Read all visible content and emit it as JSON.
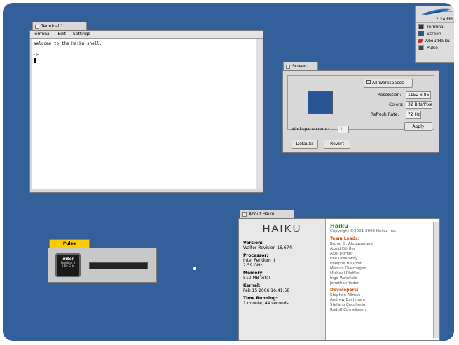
{
  "deskbar": {
    "clock": "2:24 PM",
    "items": [
      {
        "label": "Terminal",
        "icon": "terminal-icon"
      },
      {
        "label": "Screen",
        "icon": "screen-icon"
      },
      {
        "label": "AboutHaiku",
        "icon": "haiku-leaf-icon"
      },
      {
        "label": "Pulse",
        "icon": "pulse-icon"
      }
    ]
  },
  "terminal": {
    "title": "Terminal 1",
    "menu": [
      "Terminal",
      "Edit",
      "Settings"
    ],
    "lines": [
      "Welcome to the Haiku shell.",
      "",
      "~>"
    ]
  },
  "screen": {
    "title": "Screen",
    "workspaces_menu": "All Workspaces",
    "resolution_label": "Resolution:",
    "resolution_value": "1152 x 864",
    "colors_label": "Colors:",
    "colors_value": "32 Bits/Pixel",
    "refresh_label": "Refresh Rate:",
    "refresh_value": "72 Hz",
    "apply": "Apply",
    "workspace_count_label": "Workspace count:",
    "workspace_count_value": "1",
    "defaults": "Defaults",
    "revert": "Revert"
  },
  "pulse": {
    "title": "Pulse",
    "cpu_label": "Pentium II",
    "cpu_speed": "2.59 GHz",
    "load": 0.0
  },
  "about": {
    "title": "About Haiku",
    "logo": "HAIKU",
    "sections": [
      {
        "heading": "Version:",
        "value": "Walter Revision 16,674"
      },
      {
        "heading": "Processor:",
        "value": "Intel Pentium II\n2.59 GHz"
      },
      {
        "heading": "Memory:",
        "value": "512 MB total"
      },
      {
        "heading": "Kernel:",
        "value": "Feb 15 2006 16:41:58"
      },
      {
        "heading": "Time Running:",
        "value": "1 minute, 44 seconds"
      }
    ],
    "credits_title": "Haiku",
    "copyright": "Copyright ©2001-2006 Haiku, Inc.",
    "team_heading": "Team Leads:",
    "team_names": [
      "Bruno G. Albuquerque",
      "Axeld Dörfler",
      "Axel Dörfler",
      "Phil Greenway",
      "Philippe Houdoin",
      "Marcus Overhagen",
      "Michael Pfeiffer",
      "Ingo Weinhold",
      "Jonathan Yoder"
    ],
    "dev_heading": "Developers:",
    "dev_names": [
      "Stephan Aßmus",
      "Andrew Bachmann",
      "Stefano Ceccherini",
      "Rudolf Cornelissen"
    ]
  },
  "colors": {
    "desktop": "#33609b",
    "window_frame": "#d8d8d8",
    "tab_active": "#ffcc00",
    "screen_preview": "#2a5595"
  }
}
